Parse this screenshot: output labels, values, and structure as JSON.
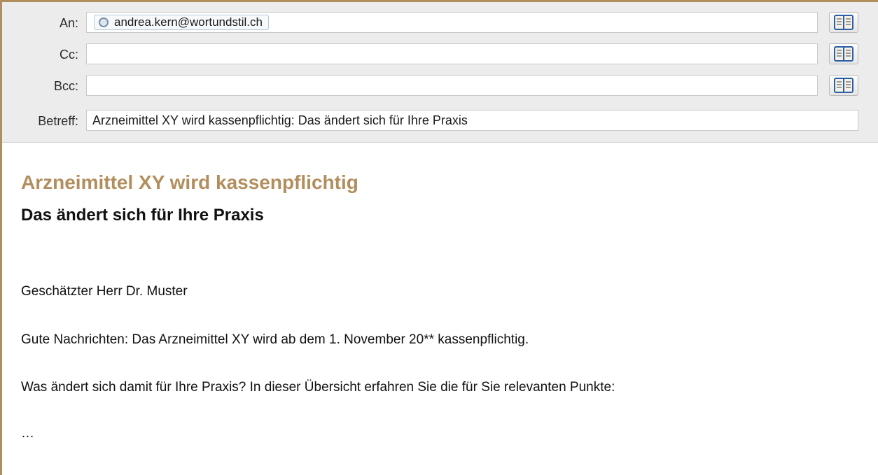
{
  "colors": {
    "accent": "#b38e5d",
    "header_bg": "#ececec"
  },
  "header": {
    "to": {
      "label": "An:",
      "recipients": [
        "andrea.kern@wortundstil.ch"
      ],
      "book_icon": "address-book-icon"
    },
    "cc": {
      "label": "Cc:",
      "value": "",
      "book_icon": "address-book-icon"
    },
    "bcc": {
      "label": "Bcc:",
      "value": "",
      "book_icon": "address-book-icon"
    },
    "subject": {
      "label": "Betreff:",
      "value": "Arzneimittel XY wird kassenpflichtig: Das ändert sich für Ihre Praxis"
    }
  },
  "message": {
    "headline": "Arzneimittel XY wird kassenpflichtig",
    "subheadline": "Das ändert sich für Ihre Praxis",
    "paragraphs": [
      "Geschätzter Herr Dr. Muster",
      "Gute Nachrichten: Das Arzneimittel XY wird ab dem 1. November 20** kassenpflichtig.",
      "Was ändert sich damit für Ihre Praxis? In dieser Übersicht erfahren Sie die für Sie relevanten Punkte:",
      "…"
    ]
  }
}
